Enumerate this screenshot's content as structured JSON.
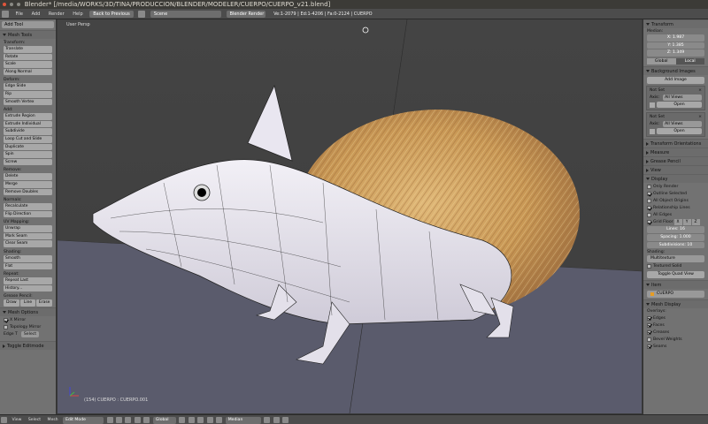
{
  "window": {
    "title": "Blender* [/media/WORKS/3D/TINA/PRODUCCION/BLENDER/MODELER/CUERPO/CUERPO_v21.blend]"
  },
  "infobar": {
    "menus": [
      "File",
      "Add",
      "Render",
      "Help"
    ],
    "back_button": "Back to Previous",
    "scene": "Scene",
    "engine": "Blender Render",
    "stats": "Ve:1-2079 | Ed:1-4206 | Fa:0-2124 | CUERPO"
  },
  "toolshelf": {
    "add_tool": "Add Tool",
    "mesh_tools_header": "Mesh Tools",
    "transform_label": "Transform:",
    "transform_buttons": [
      "Translate",
      "Rotate",
      "Scale",
      "Along Normal"
    ],
    "deform_label": "Deform:",
    "deform_buttons": [
      "Edge Slide",
      "Rip",
      "Smooth Vertex"
    ],
    "add_label": "Add:",
    "add_buttons": [
      "Extrude Region",
      "Extrude Individual",
      "Subdivide",
      "Loop Cut and Slide",
      "Duplicate",
      "Spin",
      "Screw"
    ],
    "remove_label": "Remove:",
    "remove_buttons": [
      "Delete",
      "Merge",
      "Remove Doubles"
    ],
    "normals_label": "Normals:",
    "normals_buttons": [
      "Recalculate",
      "Flip Direction"
    ],
    "uv_label": "UV Mapping:",
    "uv_buttons": [
      "Unwrap",
      "Mark Seam",
      "Clear Seam"
    ],
    "shading_label": "Shading:",
    "shading_buttons": [
      "Smooth",
      "Flat"
    ],
    "repeat_label": "Repeat:",
    "repeat_buttons": [
      "Repeat Last",
      "History..."
    ],
    "grease_label": "Grease Pencil:",
    "grease_buttons": [
      "Draw",
      "Line",
      "Erase"
    ],
    "mesh_options_header": "Mesh Options",
    "x_mirror": "X Mirror",
    "topology_mirror": "Topology Mirror",
    "edge_label": "Edge T",
    "edge_select": "Select",
    "toggle_editmode": "Toggle Editmode"
  },
  "viewport": {
    "label": "User Persp",
    "object_label": "(154) CUERPO : CUERPO.001"
  },
  "props": {
    "transform_header": "Transform",
    "median_label": "Median:",
    "x": "X: 1.987",
    "y": "Y: 1.385",
    "z": "Z: 1.349",
    "global": "Global",
    "local": "Local",
    "bg_images_header": "Background Images",
    "add_image": "Add Image",
    "not_set": "Not Set",
    "axis_label": "Axis:",
    "all_views": "All Views",
    "open": "Open",
    "transform_orientations": "Transform Orientations",
    "measure": "Measure",
    "grease_pencil": "Grease Pencil",
    "view": "View",
    "display_header": "Display",
    "only_render": "Only Render",
    "outline_selected": "Outline Selected",
    "all_object_origins": "All Object Origins",
    "relationship_lines": "Relationship Lines",
    "all_edges": "All Edges",
    "grid_floor": "Grid Floor",
    "grid_x": "X",
    "grid_y": "Y",
    "grid_z": "Z",
    "lines": "Lines: 16",
    "spacing": "Spacing: 1.000",
    "subdivisions": "Subdivisions: 10",
    "shading_label": "Shading:",
    "shading_value": "Multitexture",
    "textured_solid": "Textured Solid",
    "toggle_quad": "Toggle Quad View",
    "item_header": "Item",
    "item_name": "CUERPO",
    "mesh_display_header": "Mesh Display",
    "overlays_label": "Overlays:",
    "overlays": [
      "Edges",
      "Faces",
      "Creases",
      "Bevel Weights",
      "Seams"
    ]
  },
  "footer": {
    "items": [
      "View",
      "Select",
      "Mesh"
    ],
    "mode": "Edit Mode",
    "orientation": "Global",
    "pivot": "Median"
  },
  "colors": {
    "accent": "#e69c24",
    "fur": "#c8a060",
    "body": "#e8e6ee"
  }
}
